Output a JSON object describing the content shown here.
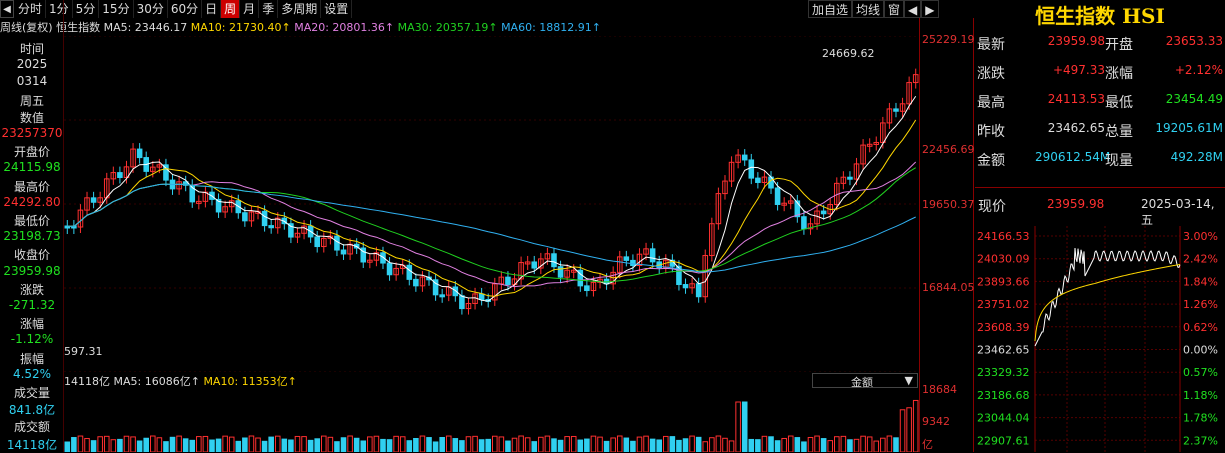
{
  "window": {
    "title": "恒生指数 HSI"
  },
  "tabs": [
    "分时",
    "1分",
    "5分",
    "15分",
    "30分",
    "60分",
    "日",
    "周",
    "月",
    "季",
    "多周期",
    "设置"
  ],
  "active_tab": "周",
  "tools": [
    "加自选",
    "均线",
    "窗"
  ],
  "left": {
    "rows": [
      {
        "k": "时间"
      },
      {
        "k": "2025"
      },
      {
        "k": "0314"
      },
      {
        "k": "周五"
      },
      {
        "k": "数值"
      },
      {
        "k": "23257370",
        "c": "red"
      },
      {
        "k": "开盘价"
      },
      {
        "k": "24115.98",
        "c": "green"
      },
      {
        "k": "最高价"
      },
      {
        "k": "24292.80",
        "c": "red"
      },
      {
        "k": "最低价"
      },
      {
        "k": "23198.73",
        "c": "green"
      },
      {
        "k": "收盘价"
      },
      {
        "k": "23959.98",
        "c": "green"
      },
      {
        "k": "涨跌"
      },
      {
        "k": "-271.32",
        "c": "green"
      },
      {
        "k": "涨幅"
      },
      {
        "k": "-1.12%",
        "c": "green"
      },
      {
        "k": "振幅"
      },
      {
        "k": "4.52%",
        "c": "cyan"
      },
      {
        "k": "成交量"
      },
      {
        "k": "841.8亿",
        "c": "cyan"
      },
      {
        "k": "成交额"
      },
      {
        "k": "14118亿",
        "c": "cyan"
      }
    ]
  },
  "ma_line": {
    "label": "周线(复权) 恒生指数",
    "ma5": "MA5: 23446.17",
    "ma10": "MA10: 21730.40↑",
    "ma20": "MA20: 20801.36↑",
    "ma30": "MA30: 20357.19↑",
    "ma60": "MA60: 18812.91↑"
  },
  "price_axis": [
    "25229.19",
    "22456.69",
    "19650.37",
    "16844.05"
  ],
  "high_label": "24669.62",
  "low_label": "597.31",
  "vol_line": {
    "total": "14118亿",
    "ma5": "MA5: 16086亿↑",
    "ma10": "MA10: 11353亿↑",
    "select": "金额"
  },
  "vol_axis": [
    "18684",
    "9342",
    "亿"
  ],
  "right": {
    "title": "恒生指数 HSI",
    "quotes": [
      {
        "k1": "最新",
        "v1": "23959.98",
        "c1": "red",
        "k2": "开盘",
        "v2": "23653.33",
        "c2": "red"
      },
      {
        "k1": "涨跌",
        "v1": "+497.33",
        "c1": "red",
        "k2": "涨幅",
        "v2": "+2.12%",
        "c2": "red"
      },
      {
        "k1": "最高",
        "v1": "24113.53",
        "c1": "red",
        "k2": "最低",
        "v2": "23454.49",
        "c2": "green"
      },
      {
        "k1": "昨收",
        "v1": "23462.65",
        "c1": "white",
        "k2": "总量",
        "v2": "19205.61M",
        "c2": "cyan"
      },
      {
        "k1": "金额",
        "v1": "290612.54M",
        "c1": "cyan",
        "k2": "现量",
        "v2": "492.28M",
        "c2": "cyan"
      }
    ],
    "now_label": "现价",
    "now_value": "23959.98",
    "date": "2025-03-14,五",
    "mini_prices": [
      "24166.53",
      "24030.09",
      "23893.66",
      "23751.02",
      "23608.39",
      "23462.65",
      "23329.32",
      "23186.68",
      "23044.04",
      "22907.61"
    ],
    "mini_pcts": [
      "3.00%",
      "2.42%",
      "1.84%",
      "1.26%",
      "0.62%",
      "0.00%",
      "0.57%",
      "1.18%",
      "1.78%",
      "2.37%"
    ]
  },
  "colors": {
    "up": "#ff3030",
    "down": "#30d0f0",
    "ma5": "#ffffff",
    "ma10": "#ffd700",
    "ma20": "#e080e0",
    "ma30": "#20d020",
    "ma60": "#30b0f0"
  }
}
